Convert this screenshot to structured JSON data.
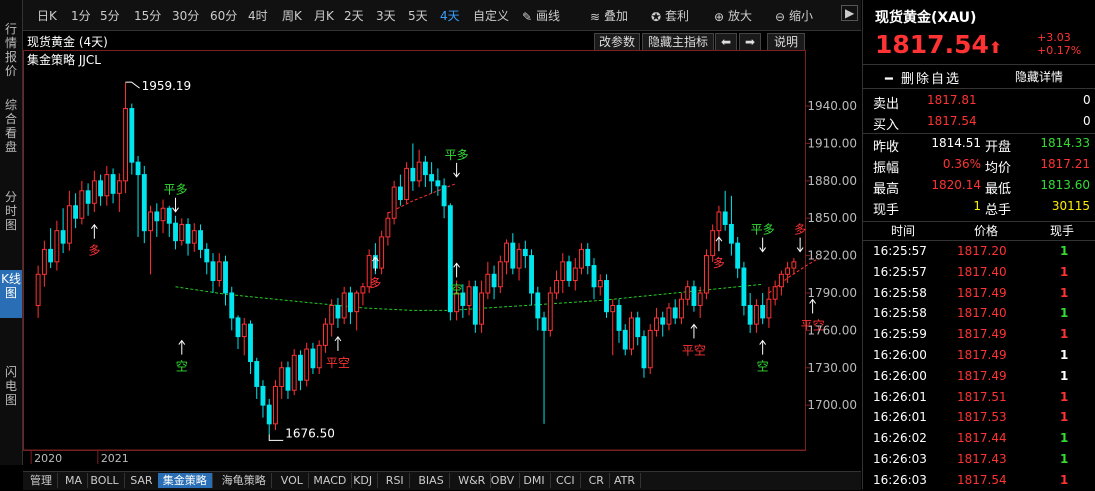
{
  "left_tabs": [
    {
      "label": "行情报价",
      "active": false
    },
    {
      "label": "综合看盘",
      "active": false
    },
    {
      "label": "分时图",
      "active": false
    },
    {
      "label": "K线图",
      "active": true
    },
    {
      "label": "闪电图",
      "active": false
    }
  ],
  "toolbar": {
    "periods": [
      "日K",
      "1分",
      "5分",
      "15分",
      "30分",
      "60分",
      "4时",
      "周K",
      "月K",
      "2天",
      "3天",
      "5天",
      "4天",
      "自定义"
    ],
    "selected_period": "4天",
    "tools": [
      "画线",
      "叠加",
      "套利",
      "放大",
      "缩小"
    ]
  },
  "chart_header": {
    "title": "现货黄金 (4天)",
    "indicator": "集金策略 JJCL",
    "buttons": [
      "改参数",
      "隐藏主指标",
      "说明"
    ]
  },
  "chart_data": {
    "type": "candlestick",
    "y_ticks": [
      1940.0,
      1910.0,
      1880.0,
      1850.0,
      1820.0,
      1790.0,
      1760.0,
      1730.0,
      1700.0
    ],
    "ylim": [
      1664,
      1985
    ],
    "x_labels": [
      "2020",
      "2021"
    ],
    "max_label": "1959.19",
    "min_label": "1676.50",
    "candles": [
      [
        1780,
        1805,
        1770,
        1812
      ],
      [
        1805,
        1825,
        1795,
        1832
      ],
      [
        1825,
        1815,
        1810,
        1842
      ],
      [
        1815,
        1840,
        1808,
        1848
      ],
      [
        1840,
        1830,
        1822,
        1858
      ],
      [
        1830,
        1860,
        1824,
        1872
      ],
      [
        1860,
        1850,
        1842,
        1870
      ],
      [
        1850,
        1872,
        1845,
        1880
      ],
      [
        1872,
        1862,
        1852,
        1878
      ],
      [
        1862,
        1880,
        1855,
        1888
      ],
      [
        1880,
        1868,
        1860,
        1885
      ],
      [
        1868,
        1885,
        1860,
        1892
      ],
      [
        1885,
        1870,
        1862,
        1890
      ],
      [
        1870,
        1880,
        1855,
        1886
      ],
      [
        1880,
        1938,
        1870,
        1959.19
      ],
      [
        1938,
        1895,
        1885,
        1942
      ],
      [
        1895,
        1885,
        1835,
        1900
      ],
      [
        1885,
        1840,
        1830,
        1892
      ],
      [
        1840,
        1855,
        1805,
        1860
      ],
      [
        1855,
        1848,
        1835,
        1862
      ],
      [
        1848,
        1858,
        1838,
        1865
      ],
      [
        1858,
        1846,
        1835,
        1860
      ],
      [
        1846,
        1832,
        1825,
        1852
      ],
      [
        1832,
        1845,
        1828,
        1850
      ],
      [
        1845,
        1830,
        1820,
        1850
      ],
      [
        1830,
        1840,
        1823,
        1846
      ],
      [
        1840,
        1825,
        1818,
        1845
      ],
      [
        1825,
        1815,
        1805,
        1830
      ],
      [
        1815,
        1800,
        1790,
        1822
      ],
      [
        1800,
        1815,
        1795,
        1822
      ],
      [
        1815,
        1790,
        1780,
        1820
      ],
      [
        1790,
        1770,
        1760,
        1795
      ],
      [
        1770,
        1755,
        1745,
        1772
      ],
      [
        1755,
        1765,
        1740,
        1770
      ],
      [
        1765,
        1735,
        1725,
        1768
      ],
      [
        1735,
        1715,
        1705,
        1738
      ],
      [
        1715,
        1700,
        1690,
        1720
      ],
      [
        1700,
        1685,
        1676.5,
        1705
      ],
      [
        1685,
        1715,
        1680,
        1720
      ],
      [
        1715,
        1730,
        1705,
        1735
      ],
      [
        1730,
        1712,
        1705,
        1735
      ],
      [
        1712,
        1740,
        1708,
        1745
      ],
      [
        1740,
        1720,
        1712,
        1744
      ],
      [
        1720,
        1745,
        1715,
        1750
      ],
      [
        1745,
        1730,
        1725,
        1750
      ],
      [
        1730,
        1748,
        1725,
        1752
      ],
      [
        1748,
        1765,
        1742,
        1770
      ],
      [
        1765,
        1780,
        1755,
        1785
      ],
      [
        1780,
        1770,
        1762,
        1786
      ],
      [
        1770,
        1790,
        1765,
        1795
      ],
      [
        1790,
        1775,
        1765,
        1795
      ],
      [
        1775,
        1790,
        1760,
        1792
      ],
      [
        1790,
        1795,
        1780,
        1798
      ],
      [
        1795,
        1820,
        1790,
        1825
      ],
      [
        1820,
        1810,
        1805,
        1830
      ],
      [
        1810,
        1835,
        1805,
        1840
      ],
      [
        1835,
        1850,
        1828,
        1855
      ],
      [
        1850,
        1875,
        1845,
        1880
      ],
      [
        1875,
        1865,
        1860,
        1885
      ],
      [
        1865,
        1890,
        1862,
        1895
      ],
      [
        1890,
        1880,
        1872,
        1910
      ],
      [
        1880,
        1895,
        1875,
        1905
      ],
      [
        1895,
        1885,
        1875,
        1900
      ],
      [
        1885,
        1880,
        1870,
        1895
      ],
      [
        1880,
        1876,
        1868,
        1890
      ],
      [
        1876,
        1860,
        1850,
        1882
      ],
      [
        1860,
        1775,
        1768,
        1862
      ],
      [
        1775,
        1790,
        1768,
        1800
      ],
      [
        1790,
        1780,
        1770,
        1797
      ],
      [
        1780,
        1795,
        1772,
        1800
      ],
      [
        1795,
        1765,
        1758,
        1800
      ],
      [
        1765,
        1790,
        1758,
        1800
      ],
      [
        1790,
        1805,
        1785,
        1815
      ],
      [
        1805,
        1795,
        1785,
        1812
      ],
      [
        1795,
        1815,
        1790,
        1820
      ],
      [
        1815,
        1830,
        1805,
        1833
      ],
      [
        1830,
        1810,
        1805,
        1838
      ],
      [
        1810,
        1825,
        1800,
        1830
      ],
      [
        1825,
        1820,
        1810,
        1832
      ],
      [
        1820,
        1790,
        1780,
        1825
      ],
      [
        1790,
        1770,
        1760,
        1795
      ],
      [
        1770,
        1760,
        1685,
        1775
      ],
      [
        1760,
        1790,
        1755,
        1795
      ],
      [
        1790,
        1800,
        1785,
        1808
      ],
      [
        1800,
        1815,
        1790,
        1822
      ],
      [
        1815,
        1800,
        1795,
        1820
      ],
      [
        1800,
        1810,
        1792,
        1818
      ],
      [
        1810,
        1825,
        1805,
        1830
      ],
      [
        1825,
        1812,
        1805,
        1830
      ],
      [
        1812,
        1795,
        1785,
        1818
      ],
      [
        1795,
        1800,
        1788,
        1805
      ],
      [
        1800,
        1775,
        1770,
        1805
      ],
      [
        1775,
        1780,
        1740,
        1785
      ],
      [
        1780,
        1760,
        1750,
        1785
      ],
      [
        1760,
        1745,
        1740,
        1765
      ],
      [
        1745,
        1770,
        1740,
        1775
      ],
      [
        1770,
        1755,
        1748,
        1775
      ],
      [
        1755,
        1730,
        1722,
        1760
      ],
      [
        1730,
        1760,
        1725,
        1765
      ],
      [
        1760,
        1770,
        1755,
        1778
      ],
      [
        1770,
        1765,
        1755,
        1775
      ],
      [
        1765,
        1778,
        1760,
        1782
      ],
      [
        1778,
        1770,
        1765,
        1785
      ],
      [
        1770,
        1785,
        1765,
        1790
      ],
      [
        1785,
        1795,
        1780,
        1800
      ],
      [
        1795,
        1780,
        1775,
        1800
      ],
      [
        1780,
        1790,
        1770,
        1795
      ],
      [
        1790,
        1820,
        1785,
        1825
      ],
      [
        1820,
        1840,
        1815,
        1845
      ],
      [
        1840,
        1855,
        1835,
        1860
      ],
      [
        1855,
        1845,
        1840,
        1872
      ],
      [
        1845,
        1830,
        1820,
        1868
      ],
      [
        1830,
        1810,
        1802,
        1835
      ],
      [
        1810,
        1780,
        1772,
        1815
      ],
      [
        1780,
        1765,
        1758,
        1790
      ],
      [
        1765,
        1780,
        1758,
        1785
      ],
      [
        1780,
        1770,
        1765,
        1790
      ],
      [
        1770,
        1785,
        1762,
        1795
      ],
      [
        1785,
        1795,
        1780,
        1800
      ],
      [
        1795,
        1805,
        1788,
        1808
      ],
      [
        1805,
        1810,
        1798,
        1815
      ],
      [
        1810,
        1815,
        1805,
        1818
      ]
    ],
    "ma_line": [
      [
        22,
        1795
      ],
      [
        30,
        1789
      ],
      [
        36,
        1786
      ],
      [
        44,
        1782
      ],
      [
        52,
        1778
      ],
      [
        60,
        1776
      ],
      [
        66,
        1776
      ],
      [
        72,
        1778
      ],
      [
        78,
        1780
      ],
      [
        84,
        1782
      ],
      [
        90,
        1784
      ],
      [
        96,
        1787
      ],
      [
        102,
        1790
      ],
      [
        108,
        1793
      ],
      [
        114,
        1796
      ],
      [
        116,
        1797
      ]
    ],
    "ma_line2": [
      [
        56,
        1854
      ],
      [
        60,
        1864
      ],
      [
        64,
        1872
      ],
      [
        67,
        1878
      ]
    ],
    "ma_line3": [
      [
        117,
        1790
      ],
      [
        120,
        1802
      ],
      [
        123,
        1812
      ],
      [
        125,
        1818
      ]
    ],
    "signals": [
      {
        "text": "多",
        "idx": 9,
        "val": 1848,
        "color": "#ff3333",
        "pos": "below"
      },
      {
        "text": "平多",
        "idx": 22,
        "val": 1852,
        "color": "#33dd33",
        "pos": "above"
      },
      {
        "text": "空",
        "idx": 23,
        "val": 1755,
        "color": "#33dd33",
        "pos": "below"
      },
      {
        "text": "平空",
        "idx": 48,
        "val": 1758,
        "color": "#ff3333",
        "pos": "below"
      },
      {
        "text": "多",
        "idx": 54,
        "val": 1822,
        "color": "#ff3333",
        "pos": "below"
      },
      {
        "text": "平多",
        "idx": 67,
        "val": 1880,
        "color": "#33dd33",
        "pos": "above"
      },
      {
        "text": "空",
        "idx": 67,
        "val": 1817,
        "color": "#33dd33",
        "pos": "below"
      },
      {
        "text": "平空",
        "idx": 105,
        "val": 1768,
        "color": "#ff3333",
        "pos": "below"
      },
      {
        "text": "多",
        "idx": 109,
        "val": 1838,
        "color": "#ff3333",
        "pos": "below"
      },
      {
        "text": "平多",
        "idx": 116,
        "val": 1820,
        "color": "#33dd33",
        "pos": "above"
      },
      {
        "text": "空",
        "idx": 116,
        "val": 1755,
        "color": "#33dd33",
        "pos": "below"
      },
      {
        "text": "多",
        "idx": 122,
        "val": 1820,
        "color": "#ff3333",
        "pos": "above"
      },
      {
        "text": "平空",
        "idx": 124,
        "val": 1788,
        "color": "#ff3333",
        "pos": "below"
      }
    ]
  },
  "bottom_tabs": [
    "管理",
    "MA",
    "BOLL",
    "SAR",
    "集金策略",
    "海龟策略",
    "VOL",
    "MACD",
    "KDJ",
    "RSI",
    "BIAS",
    "W&R",
    "OBV",
    "DMI",
    "CCI",
    "CR",
    "ATR"
  ],
  "bottom_selected": "集金策略",
  "quote": {
    "title": "现货黄金(XAU)",
    "price": "1817.54",
    "arrow": "⬆",
    "change": "+3.03",
    "change_pct": "+0.17%",
    "delete_label": "删除自选",
    "hide_label": "隐藏详情",
    "sell_label": "卖出",
    "sell_price": "1817.81",
    "sell_vol": "0",
    "buy_label": "买入",
    "buy_price": "1817.54",
    "buy_vol": "0",
    "stats": [
      {
        "l1": "昨收",
        "v1": "1814.51",
        "c1": "white",
        "l2": "开盘",
        "v2": "1814.33",
        "c2": "green"
      },
      {
        "l1": "振幅",
        "v1": "0.36%",
        "c1": "red",
        "l2": "均价",
        "v2": "1817.21",
        "c2": "red"
      },
      {
        "l1": "最高",
        "v1": "1820.14",
        "c1": "red",
        "l2": "最低",
        "v2": "1813.60",
        "c2": "green"
      },
      {
        "l1": "现手",
        "v1": "1",
        "c1": "yellow",
        "l2": "总手",
        "v2": "30115",
        "c2": "yellow"
      }
    ],
    "tick_headers": [
      "时间",
      "价格",
      "现手"
    ],
    "ticks": [
      {
        "time": "16:25:57",
        "price": "1817.20",
        "vol": "1",
        "vcolor": "green"
      },
      {
        "time": "16:25:57",
        "price": "1817.40",
        "vol": "1",
        "vcolor": "red"
      },
      {
        "time": "16:25:58",
        "price": "1817.49",
        "vol": "1",
        "vcolor": "red"
      },
      {
        "time": "16:25:58",
        "price": "1817.40",
        "vol": "1",
        "vcolor": "green"
      },
      {
        "time": "16:25:59",
        "price": "1817.49",
        "vol": "1",
        "vcolor": "red"
      },
      {
        "time": "16:26:00",
        "price": "1817.49",
        "vol": "1",
        "vcolor": "white"
      },
      {
        "time": "16:26:00",
        "price": "1817.49",
        "vol": "1",
        "vcolor": "white"
      },
      {
        "time": "16:26:01",
        "price": "1817.51",
        "vol": "1",
        "vcolor": "red"
      },
      {
        "time": "16:26:01",
        "price": "1817.53",
        "vol": "1",
        "vcolor": "red"
      },
      {
        "time": "16:26:02",
        "price": "1817.44",
        "vol": "1",
        "vcolor": "green"
      },
      {
        "time": "16:26:03",
        "price": "1817.43",
        "vol": "1",
        "vcolor": "green"
      },
      {
        "time": "16:26:03",
        "price": "1817.54",
        "vol": "1",
        "vcolor": "red"
      }
    ]
  },
  "colors": {
    "up": "#ff3333",
    "down": "#00e5ee",
    "accent": "#3aa0ff",
    "ma": "#22cc22"
  }
}
